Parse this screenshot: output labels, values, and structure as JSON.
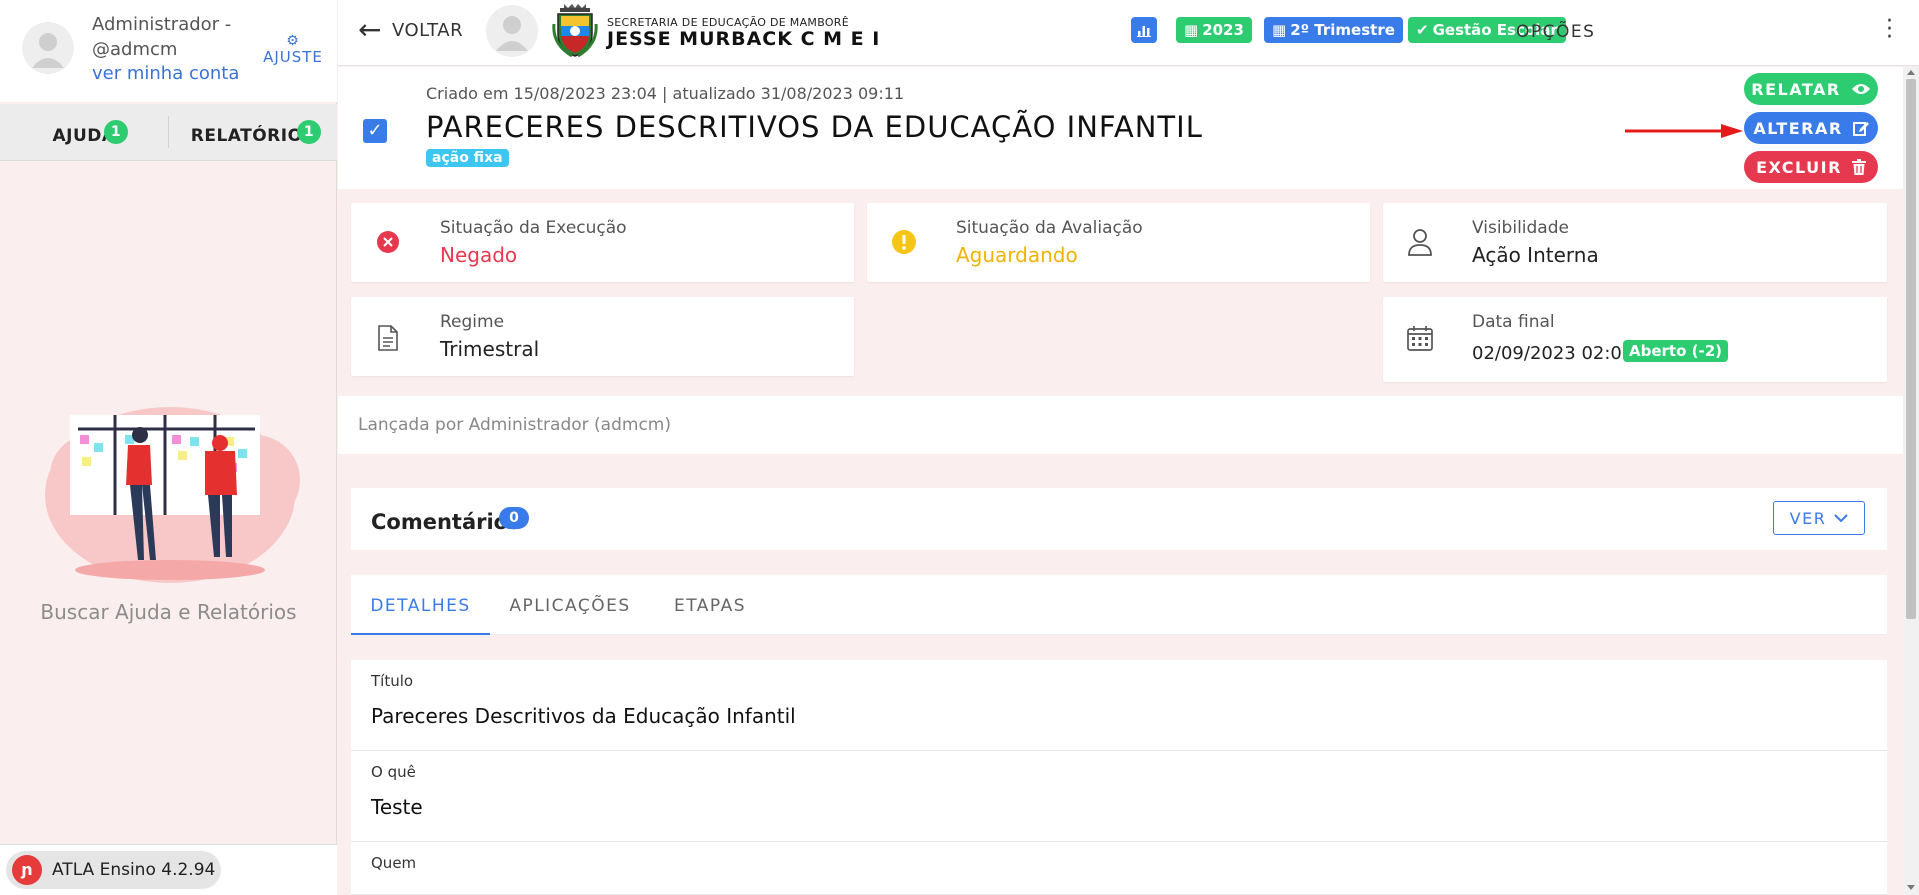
{
  "sidebar": {
    "user_name": "Administrador - @admcm",
    "account_link": "ver minha conta",
    "settings_label": "AJUSTE",
    "help_tabs": [
      {
        "label": "AJUDA",
        "badge": "1"
      },
      {
        "label": "RELATÓRIOS",
        "badge": "1"
      }
    ],
    "help_caption": "Buscar Ajuda e Relatórios",
    "version": "ATLA Ensino 4.2.94"
  },
  "header": {
    "back_label": "VOLTAR",
    "school_subtitle": "SECRETARIA DE EDUCAÇÃO DE MAMBORÊ",
    "school_name": "JESSE MURBACK C M E I",
    "pills": {
      "year": "2023",
      "term": "2º Trimestre",
      "management": "Gestão Escolar"
    },
    "options_label": "OPÇÕES"
  },
  "action": {
    "meta": "Criado em 15/08/2023 23:04 | atualizado 31/08/2023 09:11",
    "title": "PARECERES DESCRITIVOS DA EDUCAÇÃO INFANTIL",
    "tag": "ação fixa",
    "buttons": {
      "report": "RELATAR",
      "edit": "ALTERAR",
      "delete": "EXCLUIR"
    }
  },
  "info_cards": {
    "execution": {
      "label": "Situação da Execução",
      "value": "Negado"
    },
    "evaluation": {
      "label": "Situação da Avaliação",
      "value": "Aguardando"
    },
    "visibility": {
      "label": "Visibilidade",
      "value": "Ação Interna"
    },
    "regime": {
      "label": "Regime",
      "value": "Trimestral"
    },
    "end_date": {
      "label": "Data final",
      "value": "02/09/2023 02:03",
      "badge": "Aberto (-2)"
    }
  },
  "launched_by": "Lançada por Administrador (admcm)",
  "comments": {
    "title": "Comentários",
    "count": "0",
    "view_label": "VER"
  },
  "tabs": [
    "DETALHES",
    "APLICAÇÕES",
    "ETAPAS"
  ],
  "details": {
    "titulo": {
      "label": "Título",
      "value": "Pareceres Descritivos da Educação Infantil"
    },
    "oque": {
      "label": "O quê",
      "value": "Teste"
    },
    "quem": {
      "label": "Quem"
    }
  },
  "colors": {
    "primary": "#3a7bea",
    "success": "#2ecc71",
    "danger": "#e63950",
    "warning": "#f5c518",
    "background": "#fbeeee"
  }
}
